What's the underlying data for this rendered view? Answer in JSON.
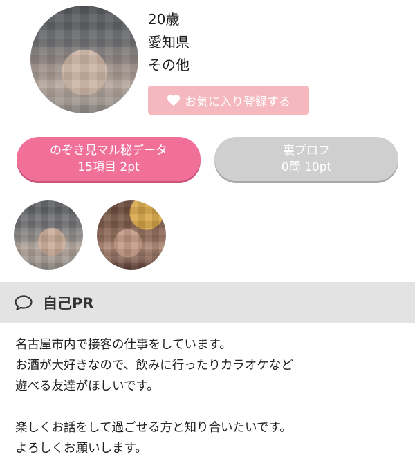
{
  "profile": {
    "age": "20歳",
    "location": "愛知県",
    "occupation": "その他",
    "favorite_button": "お気に入り登録する"
  },
  "icons": {
    "favorite": "heart-icon",
    "pr": "speech-bubble-icon"
  },
  "buttons": {
    "peek_data": {
      "title": "のぞき見マル秘データ",
      "detail": "15項目 2pt"
    },
    "secret_profile": {
      "title": "裏プロフ",
      "detail": "0問 10pt"
    }
  },
  "pr": {
    "title": "自己PR",
    "lines": [
      "名古屋市内で接客の仕事をしています。",
      "お酒が大好きなので、飲みに行ったりカラオケなど",
      "遊べる友達がほしいです。",
      "",
      "楽しくお話をして過ごせる方と知り合いたいです。",
      "よろしくお願いします。"
    ]
  },
  "colors": {
    "accent_pink": "#f0709a",
    "favorite_pink": "#f6b8bf",
    "disabled_gray": "#cfcfcf",
    "section_header_bg": "#e3e3e3"
  }
}
